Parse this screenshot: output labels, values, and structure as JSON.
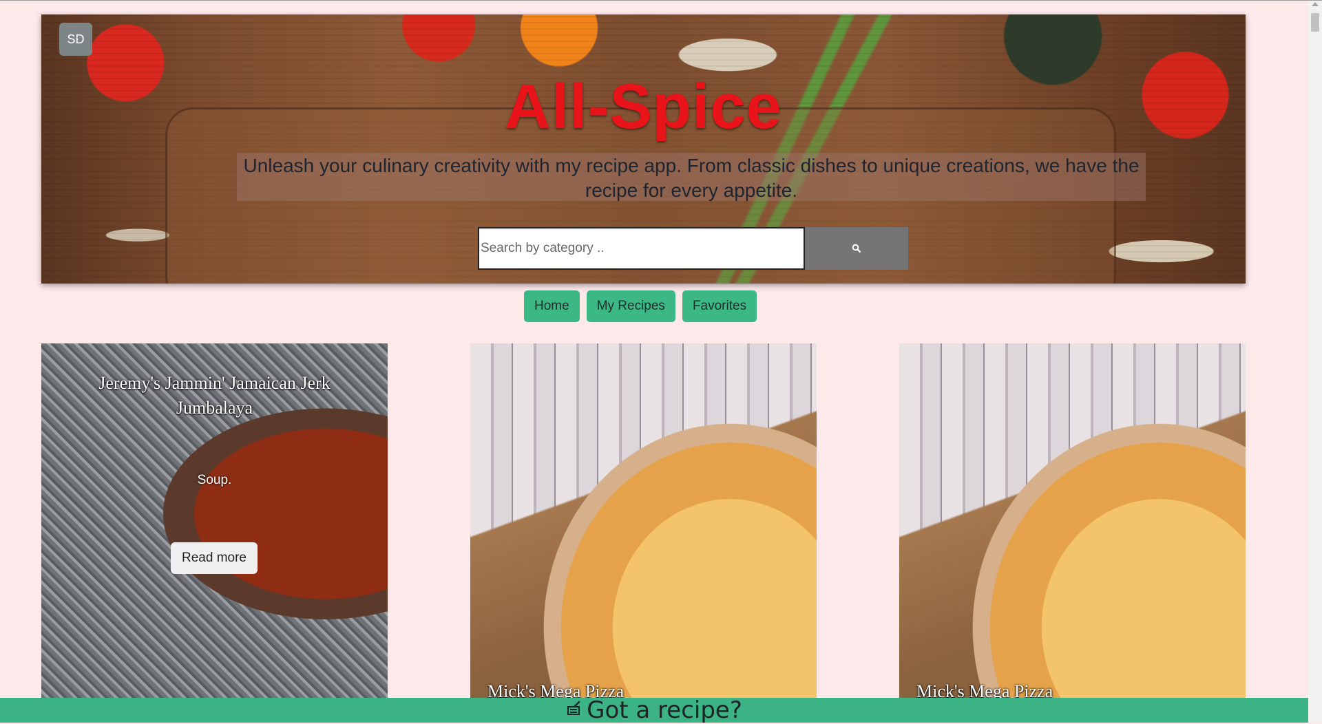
{
  "header": {
    "avatar_initials": "SD",
    "title": "All-Spice",
    "tagline": "Unleash your culinary creativity with my recipe app. From classic dishes to unique creations, we have the recipe for every appetite.",
    "search_placeholder": "Search by category ..",
    "search_icon": "search-icon"
  },
  "nav": {
    "home": "Home",
    "my_recipes": "My Recipes",
    "favorites": "Favorites"
  },
  "recipes": [
    {
      "title": "Jeremy's Jammin' Jamaican Jerk Jumbalaya",
      "category": "Soup.",
      "read_more": "Read more"
    },
    {
      "title": "Mick's Mega Pizza"
    },
    {
      "title": "Mick's Mega Pizza"
    }
  ],
  "footer": {
    "icon": "note-icon",
    "label": "Got a recipe?"
  },
  "colors": {
    "accent": "#3cb887",
    "title_red": "#e8141a",
    "page_bg": "#fde8ea"
  }
}
